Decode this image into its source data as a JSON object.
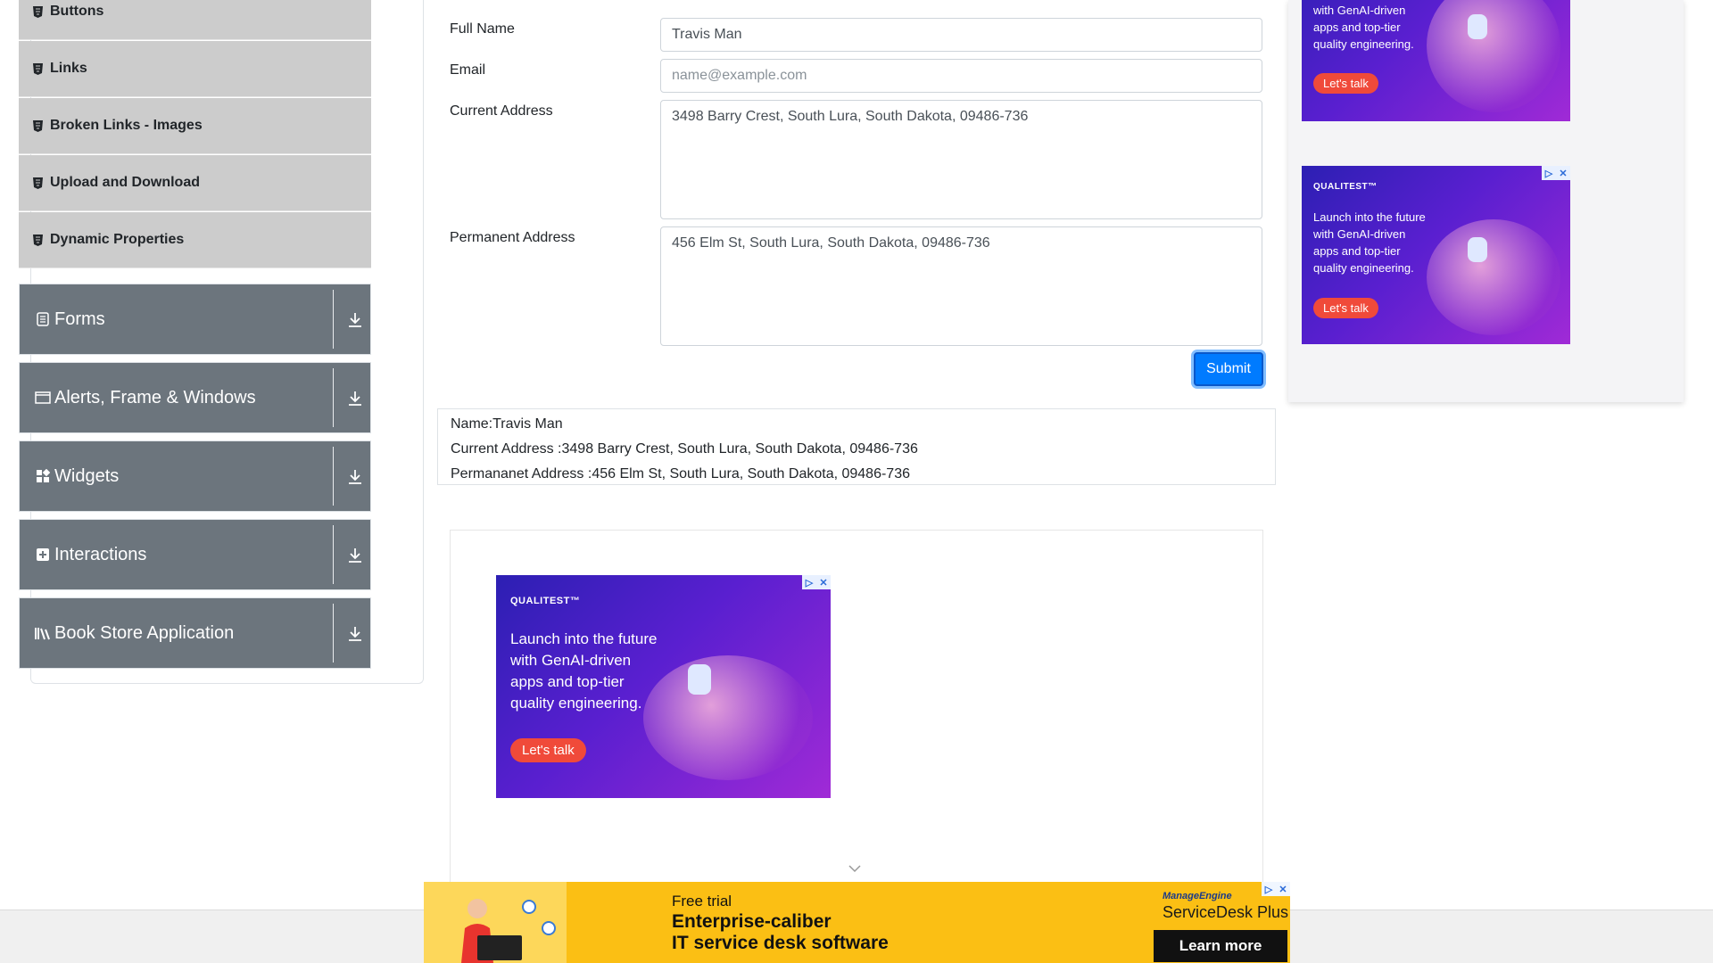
{
  "sidebar": {
    "elements_items": [
      {
        "label": "Buttons"
      },
      {
        "label": "Links"
      },
      {
        "label": "Broken Links - Images"
      },
      {
        "label": "Upload and Download"
      },
      {
        "label": "Dynamic Properties"
      }
    ],
    "groups": [
      {
        "label": "Forms",
        "icon": "form-icon"
      },
      {
        "label": "Alerts, Frame & Windows",
        "icon": "window-icon"
      },
      {
        "label": "Widgets",
        "icon": "widgets-icon"
      },
      {
        "label": "Interactions",
        "icon": "interactions-icon"
      },
      {
        "label": "Book Store Application",
        "icon": "books-icon"
      }
    ]
  },
  "form": {
    "full_name_label": "Full Name",
    "full_name_value": "Travis Man",
    "email_label": "Email",
    "email_placeholder": "name@example.com",
    "current_address_label": "Current Address",
    "current_address_value": "3498 Barry Crest, South Lura, South Dakota, 09486-736",
    "permanent_address_label": "Permanent Address",
    "permanent_address_value": "456 Elm St, South Lura, South Dakota, 09486-736",
    "submit_label": "Submit"
  },
  "output": {
    "name_line": "Name:Travis Man",
    "current_line": "Current Address :3498 Barry Crest, South Lura, South Dakota, 09486-736",
    "permanent_line": "Permananet Address :456 Elm St, South Lura, South Dakota, 09486-736"
  },
  "ads": {
    "qualitest": {
      "brand": "QUALITEST™",
      "line1": "Launch into the future",
      "line2": "with GenAI-driven",
      "line3": "apps and top-tier",
      "line4": "quality engineering.",
      "cta": "Let's talk"
    },
    "bottom": {
      "free_trial": "Free trial",
      "headline1": "Enterprise-caliber",
      "headline2": "IT service desk software",
      "brand_top": "ManageEngine",
      "brand_name": "ServiceDesk Plus",
      "cta": "Learn more"
    },
    "ad_badge": "▷",
    "ad_close": "✕"
  },
  "colors": {
    "sidebar_group_bg": "#6c757d",
    "sidebar_item_bg": "#cccccc",
    "submit_bg": "#007bff",
    "ad_accent": "#f04a3a",
    "bottom_ad_bg": "#fbbf14"
  }
}
